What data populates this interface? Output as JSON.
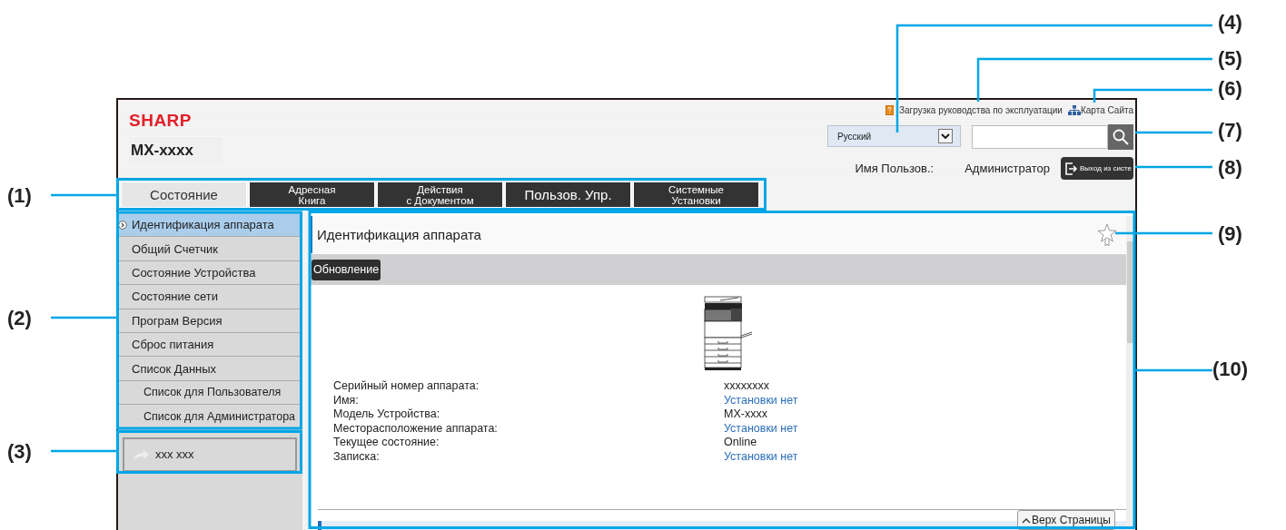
{
  "callouts": [
    {
      "label": "(1)"
    },
    {
      "label": "(2)"
    },
    {
      "label": "(3)"
    },
    {
      "label": "(4)"
    },
    {
      "label": "(5)"
    },
    {
      "label": "(6)"
    },
    {
      "label": "(7)"
    },
    {
      "label": "(8)"
    },
    {
      "label": "(9)"
    },
    {
      "label": "(10)"
    }
  ],
  "header": {
    "logo": "SHARP",
    "model": "MX-xxxx",
    "links": [
      {
        "kind": "manual",
        "label": "Загрузка руководства по эксплуатации"
      },
      {
        "kind": "sitemap",
        "label": "Карта Сайта"
      }
    ],
    "language": "Русский",
    "user_label": "Имя Пользов.:",
    "user_name": "Администратор",
    "logout": "Выход из систе"
  },
  "tabs": [
    {
      "label": "Состояние",
      "selected": true
    },
    {
      "label": "Адресная\nКнига",
      "selected": false
    },
    {
      "label": "Действия\nс Документом",
      "selected": false
    },
    {
      "label": "Пользов. Упр.",
      "selected": false
    },
    {
      "label": "Системные\nУстановки",
      "selected": false
    }
  ],
  "sidebar": {
    "items": [
      {
        "label": "Идентификация аппарата",
        "selected": true
      },
      {
        "label": "Общий Счетчик",
        "selected": false
      },
      {
        "label": "Состояние Устройства",
        "selected": false
      },
      {
        "label": "Состояние сети",
        "selected": false
      },
      {
        "label": "Програм Версия",
        "selected": false
      },
      {
        "label": "Сброс питания",
        "selected": false
      },
      {
        "label": "Список Данных",
        "selected": false,
        "children": [
          {
            "label": "Список для Пользователя",
            "selected": false
          },
          {
            "label": "Список для Администратора",
            "selected": false
          }
        ]
      }
    ],
    "link_button": "xxx xxx"
  },
  "content": {
    "title": "Идентификация аппарата",
    "favorite": false,
    "refresh_button": "Обновление",
    "fields": [
      {
        "label": "Серийный номер аппарата:",
        "value": "xxxxxxxx",
        "kind": "text"
      },
      {
        "label": "Имя:",
        "value": "Установки нет",
        "kind": "link"
      },
      {
        "label": "Модель Устройства:",
        "value": "MX-xxxx",
        "kind": "text"
      },
      {
        "label": "Месторасположение аппарата:",
        "value": "Установки нет",
        "kind": "link"
      },
      {
        "label": "Текущее состояние:",
        "value": "Online",
        "kind": "text"
      },
      {
        "label": "Записка:",
        "value": "Установки нет",
        "kind": "link"
      }
    ],
    "top_button": "Верх Страницы"
  }
}
